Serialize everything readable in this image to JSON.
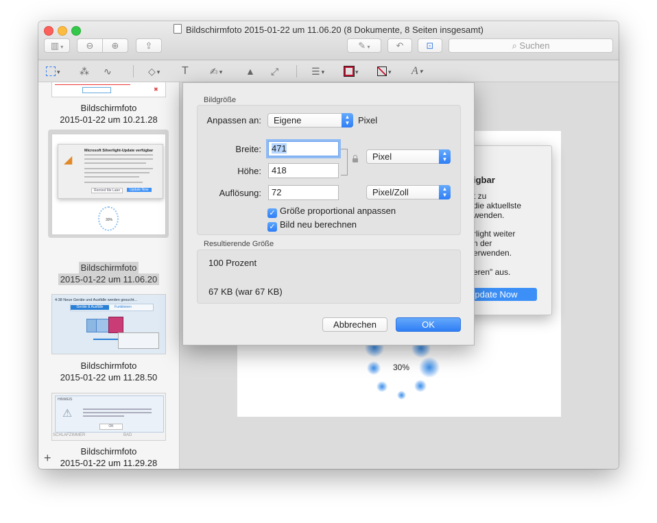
{
  "window": {
    "title": "Bildschirmfoto 2015-01-22 um 11.06.20 (8 Dokumente, 8 Seiten insgesamt)",
    "search_placeholder": "Suchen"
  },
  "toolbar_icons": [
    "sidebar-icon",
    "zoom-out-icon",
    "zoom-in-icon",
    "share-icon",
    "markup-icon",
    "rotate-icon",
    "toolbox-icon"
  ],
  "markup_tools": [
    "rect-select-icon",
    "instant-alpha-icon",
    "sketch-icon",
    "shapes-icon",
    "text-icon",
    "signature-icon",
    "adjust-color-icon",
    "adjust-size-icon",
    "line-style-icon",
    "border-color-icon",
    "fill-color-icon",
    "font-style-icon"
  ],
  "sidebar": {
    "items": [
      {
        "name": "Bildschirmfoto",
        "date": "2015-01-22 um 10.21.28",
        "selected": false
      },
      {
        "name": "Bildschirmfoto",
        "date": "2015-01-22 um 11.06.20",
        "selected": true
      },
      {
        "name": "Bildschirmfoto",
        "date": "2015-01-22 um 11.28.50",
        "selected": false
      },
      {
        "name": "Bildschirmfoto",
        "date": "2015-01-22 um 11.29.28",
        "selected": false
      }
    ],
    "add_label": "+"
  },
  "thumb2": {
    "title": "Microsoft Silverlight-Update verfügbar",
    "remind": "Remind Me Later",
    "update": "Update Now",
    "pct": "30%"
  },
  "thumb3": {
    "header": "4:38  Neue Geräte und Ausfälle werden gesucht...",
    "tab1": "Geräte & Ausfälle",
    "tab2": "Funktionen"
  },
  "thumb4": {
    "header": "HINWEIS",
    "ok": "OK",
    "room1": "SCHLAFZIMMER",
    "room2": "BAD"
  },
  "background_doc": {
    "lines": [
      "igbar",
      "t zu",
      "die aktuellste",
      "wenden.",
      "rlight weiter",
      "n der",
      "erwenden.",
      "eren\" aus."
    ],
    "update_button": "Update Now",
    "percent": "30%"
  },
  "dialog": {
    "size_section": "Bildgröße",
    "fit_label": "Anpassen an:",
    "fit_value": "Eigene",
    "fit_unit": "Pixel",
    "width_label": "Breite:",
    "width_value": "471",
    "height_label": "Höhe:",
    "height_value": "418",
    "unit_value": "Pixel",
    "resolution_label": "Auflösung:",
    "resolution_value": "72",
    "resolution_unit": "Pixel/Zoll",
    "proportional_label": "Größe proportional anpassen",
    "proportional_checked": true,
    "resample_label": "Bild neu berechnen",
    "resample_checked": true,
    "result_section": "Resultierende Größe",
    "result_percent": "100 Prozent",
    "result_size": "67 KB (war 67 KB)",
    "cancel_label": "Abbrechen",
    "ok_label": "OK"
  }
}
